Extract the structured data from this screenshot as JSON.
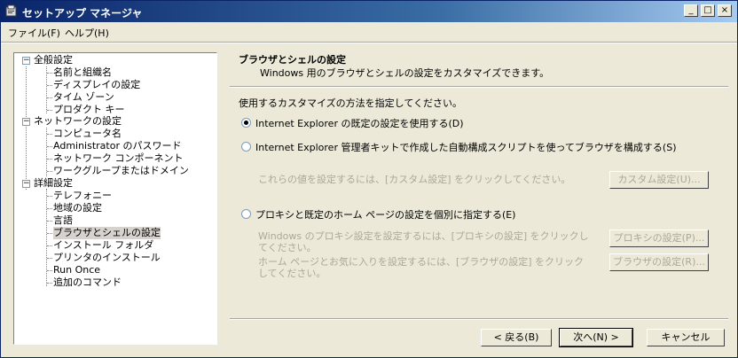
{
  "window": {
    "title": "セットアップ マネージャ",
    "minimize": "_",
    "maximize": "□",
    "close": "×"
  },
  "menu": {
    "file": "ファイル(F)",
    "help": "ヘルプ(H)"
  },
  "tree": {
    "general": {
      "label": "全般設定",
      "items": [
        "名前と組織名",
        "ディスプレイの設定",
        "タイム ゾーン",
        "プロダクト キー"
      ]
    },
    "network": {
      "label": "ネットワークの設定",
      "items": [
        "コンピュータ名",
        "Administrator のパスワード",
        "ネットワーク コンポーネント",
        "ワークグループまたはドメイン"
      ]
    },
    "advanced": {
      "label": "詳細設定",
      "items": [
        "テレフォニー",
        "地域の設定",
        "言語",
        "ブラウザとシェルの設定",
        "インストール フォルダ",
        "プリンタのインストール",
        "Run Once",
        "追加のコマンド"
      ]
    },
    "toggle": "−"
  },
  "panel": {
    "title": "ブラウザとシェルの設定",
    "description": "Windows 用のブラウザとシェルの設定をカスタマイズできます。",
    "prompt": "使用するカスタマイズの方法を指定してください。",
    "option1": "Internet Explorer の既定の設定を使用する(D)",
    "option2": "Internet Explorer 管理者キットで作成した自動構成スクリプトを使ってブラウザを構成する(S)",
    "option2_note": "これらの値を設定するには、[カスタム設定] をクリックしてください。",
    "custom_button": "カスタム設定(U)...",
    "option3": "プロキシと既定のホーム ページの設定を個別に指定する(E)",
    "proxy_note": "Windows のプロキシ設定を設定するには、[プロキシの設定] をクリックしてください。",
    "proxy_button": "プロキシの設定(P)...",
    "browser_note": "ホーム ページとお気に入りを設定するには、[ブラウザの設定] をクリックしてください。",
    "browser_button": "ブラウザの設定(R)..."
  },
  "footer": {
    "back": "< 戻る(B)",
    "next": "次へ(N) >",
    "cancel": "キャンセル"
  }
}
